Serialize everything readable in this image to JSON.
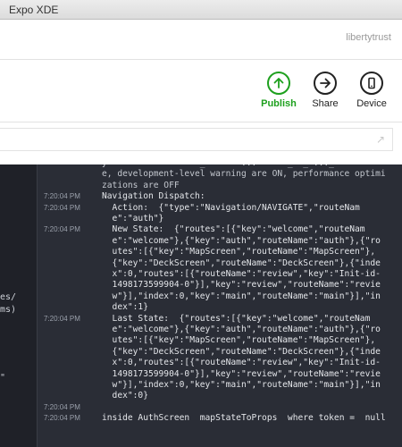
{
  "window": {
    "title": "Expo XDE"
  },
  "account": {
    "username": "libertytrust"
  },
  "toolbar": {
    "publish_label": "Publish",
    "share_label": "Share",
    "device_label": "Device",
    "publish_color": "#1ea01e"
  },
  "urlbar": {
    "value": "",
    "open_icon": "external-link-icon"
  },
  "left_logs": {
    "lines": [
      "es/",
      "ms)",
      "\""
    ]
  },
  "logs": [
    {
      "time": "",
      "text": "y                  _       ...      _  _ ..._"
    },
    {
      "time": "",
      "text": "e, development-level warning are ON, performance optimi"
    },
    {
      "time": "",
      "text": "zations are OFF"
    },
    {
      "time": "7:20:04 PM",
      "text": "Navigation Dispatch:"
    },
    {
      "time": "7:20:04 PM",
      "text": "  Action:  {\"type\":\"Navigation/NAVIGATE\",\"routeNam"
    },
    {
      "time": "",
      "text": "  e\":\"auth\"}"
    },
    {
      "time": "7:20:04 PM",
      "text": "  New State:  {\"routes\":[{\"key\":\"welcome\",\"routeNam"
    },
    {
      "time": "",
      "text": "  e\":\"welcome\"},{\"key\":\"auth\",\"routeName\":\"auth\"},{\"ro"
    },
    {
      "time": "",
      "text": "  utes\":[{\"key\":\"MapScreen\",\"routeName\":\"MapScreen\"},"
    },
    {
      "time": "",
      "text": "  {\"key\":\"DeckScreen\",\"routeName\":\"DeckScreen\"},{\"inde"
    },
    {
      "time": "",
      "text": "  x\":0,\"routes\":[{\"routeName\":\"review\",\"key\":\"Init-id-"
    },
    {
      "time": "",
      "text": "  1498173599904-0\"}],\"key\":\"review\",\"routeName\":\"revie"
    },
    {
      "time": "",
      "text": "  w\"}],\"index\":0,\"key\":\"main\",\"routeName\":\"main\"}],\"in"
    },
    {
      "time": "",
      "text": "  dex\":1}"
    },
    {
      "time": "7:20:04 PM",
      "text": "  Last State:  {\"routes\":[{\"key\":\"welcome\",\"routeNam"
    },
    {
      "time": "",
      "text": "  e\":\"welcome\"},{\"key\":\"auth\",\"routeName\":\"auth\"},{\"ro"
    },
    {
      "time": "",
      "text": "  utes\":[{\"key\":\"MapScreen\",\"routeName\":\"MapScreen\"},"
    },
    {
      "time": "",
      "text": "  {\"key\":\"DeckScreen\",\"routeName\":\"DeckScreen\"},{\"inde"
    },
    {
      "time": "",
      "text": "  x\":0,\"routes\":[{\"routeName\":\"review\",\"key\":\"Init-id-"
    },
    {
      "time": "",
      "text": "  1498173599904-0\"}],\"key\":\"review\",\"routeName\":\"revie"
    },
    {
      "time": "",
      "text": "  w\"}],\"index\":0,\"key\":\"main\",\"routeName\":\"main\"}],\"in"
    },
    {
      "time": "",
      "text": "  dex\":0}"
    },
    {
      "time": "7:20:04 PM",
      "text": ""
    },
    {
      "time": "7:20:04 PM",
      "text": "inside AuthScreen  mapStateToProps  where token =  null"
    }
  ]
}
